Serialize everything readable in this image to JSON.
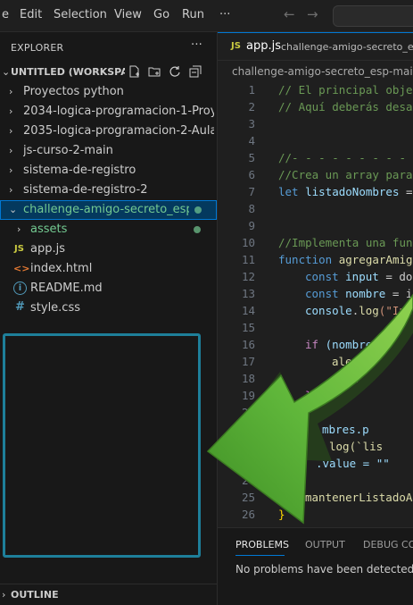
{
  "menu": [
    "e",
    "Edit",
    "Selection",
    "View",
    "Go",
    "Run",
    "···"
  ],
  "explorer": {
    "title": "EXPLORER",
    "more": "···",
    "workspace": "UNTITLED (WORKSPA...",
    "folders": [
      "Proyectos python",
      "2034-logica-programacion-1-Proye...",
      "2035-logica-programacion-2-Aula1",
      "js-curso-2-main",
      "sistema-de-registro",
      "sistema-de-registro-2"
    ],
    "open_folder": "challenge-amigo-secreto_esp-...",
    "children": [
      {
        "icon": "",
        "name": "assets"
      },
      {
        "icon": "JS",
        "name": "app.js"
      },
      {
        "icon": "<>",
        "name": "index.html"
      },
      {
        "icon": "i",
        "name": "README.md"
      },
      {
        "icon": "#",
        "name": "style.css"
      }
    ],
    "outline": "OUTLINE"
  },
  "editor": {
    "tab_icon": "JS",
    "tab_file": "app.js",
    "tab_path": "challenge-amigo-secreto_esp",
    "breadcrumb": "challenge-amigo-secreto_esp-main",
    "line_numbers": [
      "1",
      "2",
      "3",
      "4",
      "5",
      "6",
      "7",
      "8",
      "9",
      "10",
      "11",
      "12",
      "13",
      "14",
      "15",
      "16",
      "17",
      "18",
      "19",
      "20",
      "21",
      "22",
      "23",
      "24",
      "25",
      "26"
    ],
    "lines": {
      "l1": "// El principal obje",
      "l2": "// Aquí deberás desa",
      "l5": "//- - - - - - - - - -",
      "l6": "//Crea un array para",
      "l7_kw": "let ",
      "l7_var": "listadoNombres",
      "l7_rest": " =",
      "l10": "//Implementa una fun",
      "l11_kw": "function ",
      "l11_fn": "agregarAmig",
      "l12_kw": "const ",
      "l12_var": "input",
      "l12_rest": " = do",
      "l13_kw": "const ",
      "l13_var": "nombre",
      "l13_rest": " = i",
      "l14_var": "console",
      "l14_fn": "log",
      "l14_str": "(\"Inc",
      "l16_kw": "if ",
      "l16_rest": "(nombre =",
      "l17": "alert(",
      "l18": "retu",
      "l19": "}",
      "l21": "mbres.p",
      "l22": "log(`lis",
      "l23": ".value = \"\"",
      "l25": "mantenerListadoA",
      "l26": "}"
    }
  },
  "panel": {
    "tabs": [
      "PROBLEMS",
      "OUTPUT",
      "DEBUG CON"
    ],
    "message": "No problems have been detected i"
  },
  "colors": {
    "accent": "#0078d4",
    "arrow": "#5fb63a",
    "box": "#1e7f9a"
  }
}
